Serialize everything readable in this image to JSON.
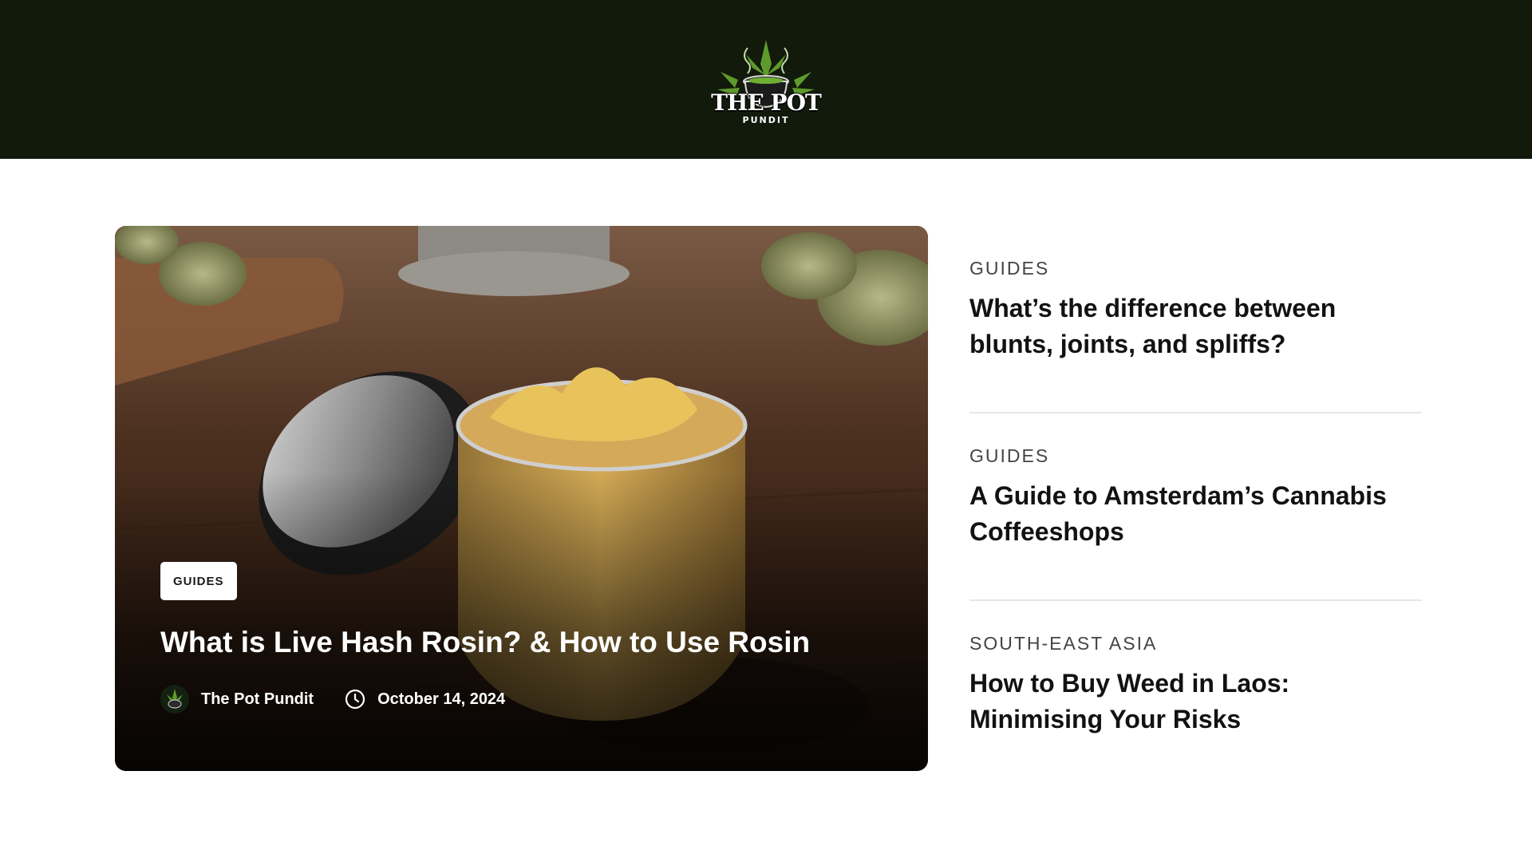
{
  "header": {
    "logo_text": "THE POT",
    "logo_subtext": "PUNDIT",
    "logo_icon": "cannabis-leaf-cauldron-logo"
  },
  "featured": {
    "category": "GUIDES",
    "title": "What is Live Hash Rosin? & How to Use Rosin",
    "author": "The Pot Pundit",
    "date": "October 14, 2024",
    "author_icon": "avatar-icon",
    "date_icon": "clock-icon"
  },
  "sidebar": {
    "items": [
      {
        "category": "GUIDES",
        "title": "What’s the difference between blunts, joints, and spliffs?"
      },
      {
        "category": "GUIDES",
        "title": "A Guide to Amsterdam’s Cannabis Coffeeshops"
      },
      {
        "category": "SOUTH-EAST ASIA",
        "title": "How to Buy Weed in Laos: Minimising Your Risks"
      }
    ]
  },
  "colors": {
    "header_bg": "#121a0b",
    "page_bg": "#ffffff",
    "title_text": "#121212",
    "category_text": "#444444",
    "divider": "#e6e6e6"
  }
}
